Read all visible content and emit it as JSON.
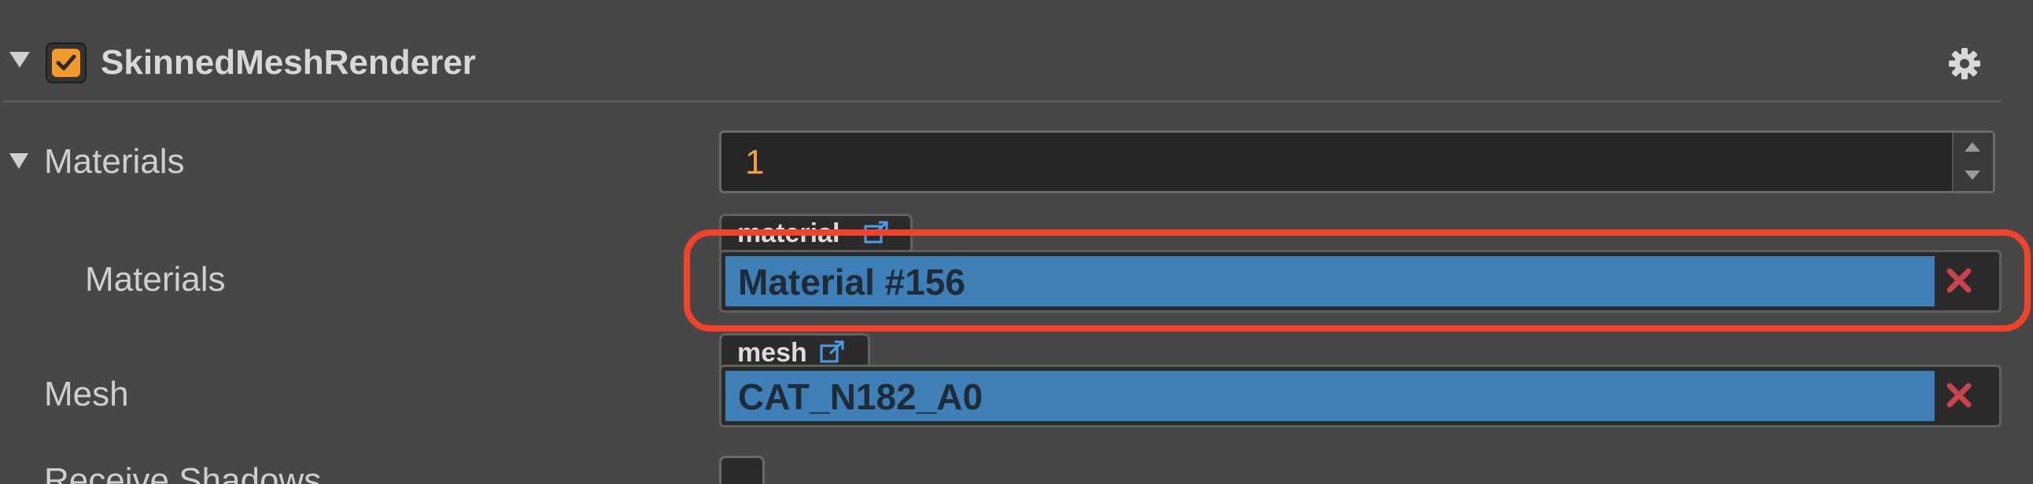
{
  "component": {
    "title": "SkinnedMeshRenderer",
    "enabled": true,
    "collapse_icon": "triangle-down-icon",
    "settings_icon": "gear-icon"
  },
  "materials_array": {
    "label": "Materials",
    "expanded": true,
    "count": "1"
  },
  "material_item": {
    "label": "Materials",
    "tag": "material",
    "value": "Material #156"
  },
  "mesh": {
    "label": "Mesh",
    "tag": "mesh",
    "value": "CAT_N182_A0"
  },
  "receive_shadows": {
    "label": "Receive Shadows",
    "checked": false
  },
  "colors": {
    "background": "#474747",
    "accent_orange": "#f39a2a",
    "asset_blue": "#3f7fb7",
    "highlight_red": "#f4412a",
    "clear_red": "#c8434b"
  }
}
